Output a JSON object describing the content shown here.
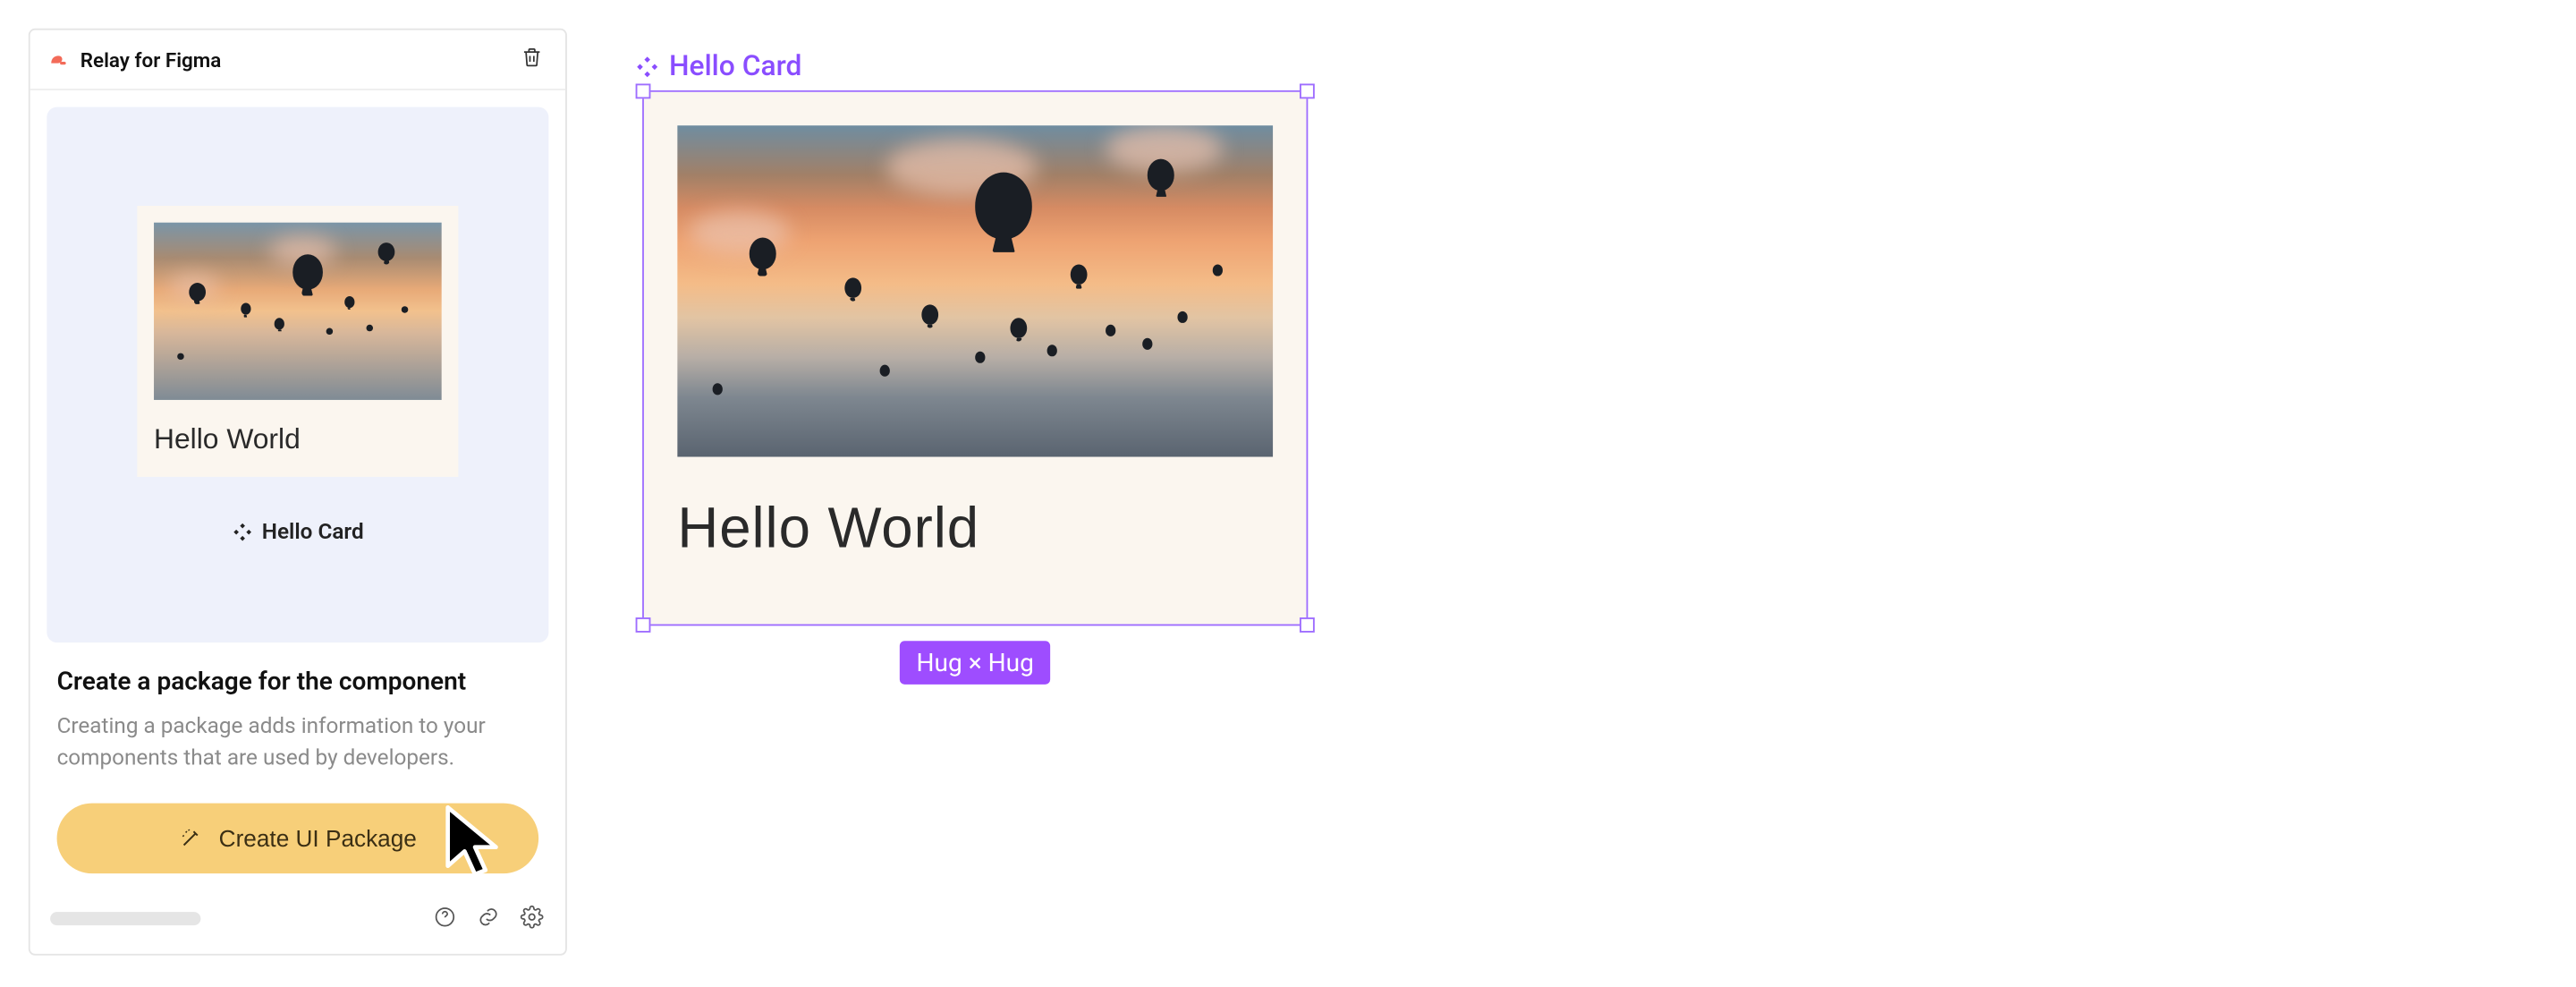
{
  "panel": {
    "title": "Relay for Figma",
    "preview_card_title": "Hello World",
    "component_label": "Hello Card",
    "section_heading": "Create a package for the component",
    "section_desc": "Creating a package adds information to your components that are used by developers.",
    "cta_label": "Create UI Package"
  },
  "canvas": {
    "component_label": "Hello Card",
    "card_title": "Hello World",
    "layout_badge": "Hug × Hug"
  },
  "colors": {
    "selection": "#9e6dff",
    "cta_bg": "#f7cf79",
    "preview_bg": "#eef1fb",
    "card_bg": "#fbf6ef"
  }
}
